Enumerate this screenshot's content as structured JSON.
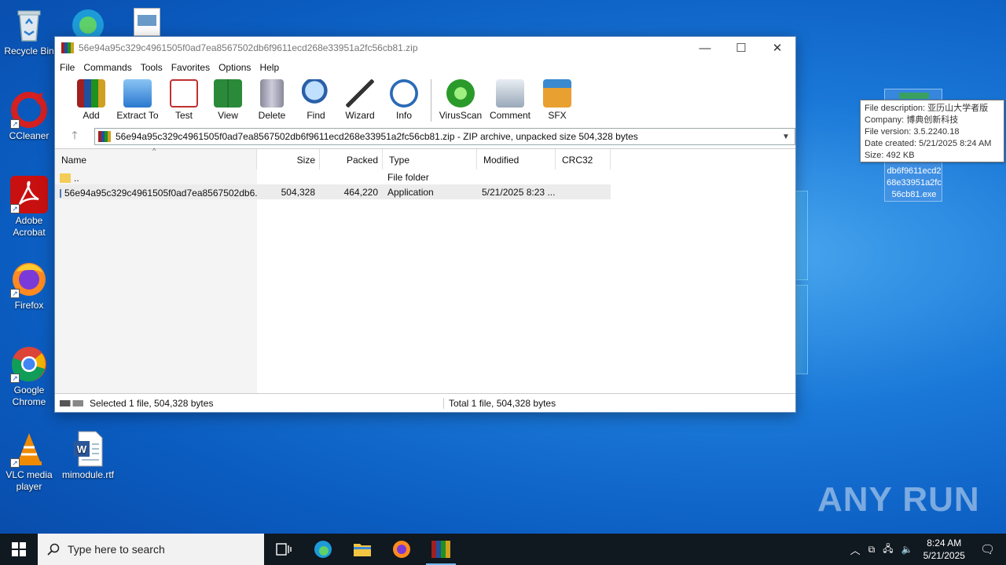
{
  "desktop": {
    "icons": [
      {
        "label": "Recycle Bin"
      },
      {
        "label": "CCleaner"
      },
      {
        "label": "Adobe Acrobat"
      },
      {
        "label": "Firefox"
      },
      {
        "label": "Google Chrome"
      },
      {
        "label": "VLC media player"
      },
      {
        "label": "mimodule.rtf"
      }
    ],
    "selected_file_label": "db6f9611ecd268e33951a2fc56cb81.exe",
    "tooltip": {
      "description": "File description: 亚历山大学者版",
      "company": "Company: 博典创新科技",
      "version": "File version: 3.5.2240.18",
      "created": "Date created: 5/21/2025 8:24 AM",
      "size": "Size: 492 KB"
    }
  },
  "window": {
    "title": "56e94a95c329c4961505f0ad7ea8567502db6f9611ecd268e33951a2fc56cb81.zip",
    "menu": [
      "File",
      "Commands",
      "Tools",
      "Favorites",
      "Options",
      "Help"
    ],
    "toolbar": [
      "Add",
      "Extract To",
      "Test",
      "View",
      "Delete",
      "Find",
      "Wizard",
      "Info",
      "VirusScan",
      "Comment",
      "SFX"
    ],
    "address": "56e94a95c329c4961505f0ad7ea8567502db6f9611ecd268e33951a2fc56cb81.zip - ZIP archive, unpacked size 504,328 bytes",
    "columns": [
      "Name",
      "Size",
      "Packed",
      "Type",
      "Modified",
      "CRC32"
    ],
    "rows": [
      {
        "name": "..",
        "size": "",
        "packed": "",
        "type": "File folder",
        "modified": ""
      },
      {
        "name": "56e94a95c329c4961505f0ad7ea8567502db6...",
        "size": "504,328",
        "packed": "464,220",
        "type": "Application",
        "modified": "5/21/2025 8:23 ..."
      }
    ],
    "status_left": "Selected 1 file, 504,328 bytes",
    "status_right": "Total 1 file, 504,328 bytes"
  },
  "watermark": "ANY RUN",
  "taskbar": {
    "search_placeholder": "Type here to search",
    "time": "8:24 AM",
    "date": "5/21/2025"
  }
}
